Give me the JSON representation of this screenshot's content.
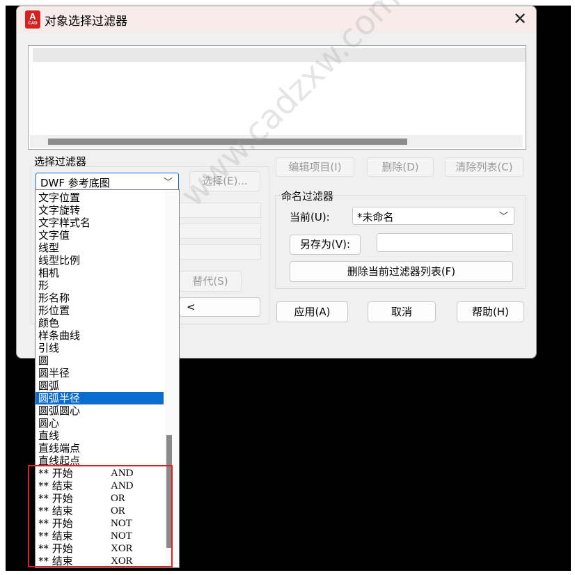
{
  "window": {
    "title": "对象选择过滤器",
    "app_icon_text": "A",
    "app_icon_sub": "CAD"
  },
  "select_filter": {
    "legend": "选择过滤器",
    "combo_value": "DWF 参考底图",
    "select_button": "选择(E)...",
    "replace_button": "替代(S)",
    "arrow_button": "<"
  },
  "edit_buttons": {
    "edit_item": "编辑项目(I)",
    "delete": "删除(D)",
    "clear_list": "清除列表(C)"
  },
  "named_filter": {
    "legend": "命名过滤器",
    "current_label": "当前(U):",
    "current_value": "*未命名",
    "save_as_button": "另存为(V):",
    "save_as_value": "",
    "delete_current_button": "删除当前过滤器列表(F)"
  },
  "actions": {
    "apply": "应用(A)",
    "cancel": "取消",
    "help": "帮助(H)"
  },
  "dropdown_items": [
    "文字位置",
    "文字旋转",
    "文字样式名",
    "文字值",
    "线型",
    "线型比例",
    "相机",
    "形",
    "形名称",
    "形位置",
    "颜色",
    "样条曲线",
    "引线",
    "圆",
    "圆半径",
    "圆弧",
    "圆弧半径",
    "圆弧圆心",
    "圆心",
    "直线",
    "直线端点",
    "直线起点"
  ],
  "dropdown_selected_index": 16,
  "operator_items": [
    {
      "prefix": "** 开始",
      "op": "AND"
    },
    {
      "prefix": "** 结束",
      "op": "AND"
    },
    {
      "prefix": "** 开始",
      "op": "OR"
    },
    {
      "prefix": "** 结束",
      "op": "OR"
    },
    {
      "prefix": "** 开始",
      "op": "NOT"
    },
    {
      "prefix": "** 结束",
      "op": "NOT"
    },
    {
      "prefix": "** 开始",
      "op": "XOR"
    },
    {
      "prefix": "** 结束",
      "op": "XOR"
    }
  ],
  "watermark": "www.cadzxw.com CAD自学网",
  "colors": {
    "selection": "#0a6ccf",
    "highlight_box": "#e02020",
    "title_bar": "#f7ece9"
  }
}
